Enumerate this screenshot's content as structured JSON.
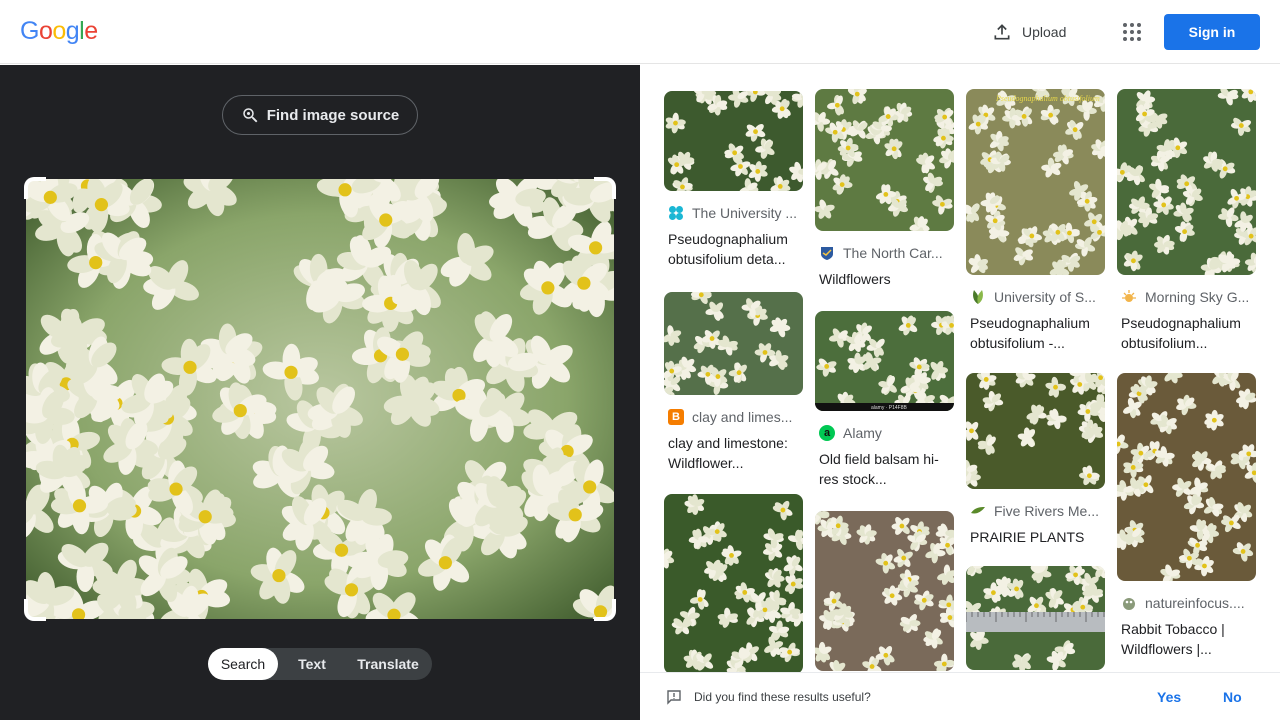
{
  "brand": {
    "logo_letters": [
      "G",
      "o",
      "o",
      "g",
      "l",
      "e"
    ],
    "logo_colors": [
      "#4285f4",
      "#ea4335",
      "#fbbc05",
      "#4285f4",
      "#34a853",
      "#ea4335"
    ]
  },
  "header": {
    "upload_label": "Upload",
    "signin_label": "Sign in",
    "accent": "#1a73e8"
  },
  "lens": {
    "find_source_label": "Find image source",
    "modes": [
      {
        "label": "Search",
        "active": true
      },
      {
        "label": "Text",
        "active": false
      },
      {
        "label": "Translate",
        "active": false
      }
    ],
    "query_image": "white-wildflower-cluster-photo"
  },
  "results": [
    {
      "source": "The University ...",
      "title": "Pseudognaphalium obtusifolium deta...",
      "icon": "butterfly-icon",
      "icon_color": "#1ab7d4",
      "bg": "#3d5a2e"
    },
    {
      "source": "The North Car...",
      "title": "Wildflowers",
      "icon": "shield-icon",
      "icon_color": "#2c5aa0",
      "bg": "#5e7a42"
    },
    {
      "source": "University of S...",
      "title": "Pseudognaphalium obtusifolium -...",
      "icon": "leaf-icon",
      "icon_color": "#6a9a3a",
      "bg": "#8a8a5a"
    },
    {
      "source": "Morning Sky G...",
      "title": "Pseudognaphalium obtusifolium...",
      "icon": "sun-icon",
      "icon_color": "#e8a04a",
      "bg": "#4a6a3a"
    },
    {
      "source": "clay and limes...",
      "title": "clay and limestone: Wildflower...",
      "icon": "blogger-icon",
      "icon_color": "#f57d00",
      "bg": "#55704a"
    },
    {
      "source": "Alamy",
      "title": "Old field balsam hi-res stock...",
      "icon": "alamy-icon",
      "icon_color": "#00c853",
      "bg": "#4c6e3c"
    },
    {
      "source": "Five Rivers Me...",
      "title": "PRAIRIE PLANTS",
      "icon": "leaf-icon",
      "icon_color": "#5a8a2a",
      "bg": "#4a5a2a"
    },
    {
      "source": "natureinfocus....",
      "title": "Rabbit Tobacco | Wildflowers |...",
      "icon": "frog-icon",
      "icon_color": "#7a8a6a",
      "bg": "#6a5a3a"
    },
    {
      "source": "",
      "title": "",
      "icon": "",
      "icon_color": "",
      "bg": "#3a5a2a"
    },
    {
      "source": "",
      "title": "",
      "icon": "",
      "icon_color": "",
      "bg": "#7a6a5a"
    },
    {
      "source": "",
      "title": "",
      "icon": "",
      "icon_color": "",
      "bg": "#4a6a3a"
    }
  ],
  "thumb_captions": {
    "r3": "Pseudognaphalium obtusifolium",
    "r6": "alamy · P14F8B"
  },
  "feedback": {
    "question": "Did you find these results useful?",
    "yes": "Yes",
    "no": "No"
  }
}
